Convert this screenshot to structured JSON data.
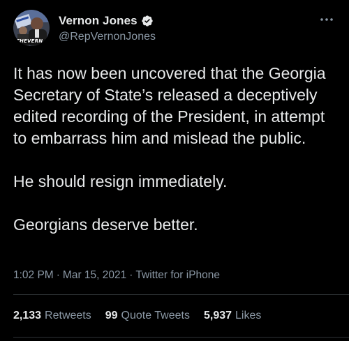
{
  "user": {
    "display_name": "Vernon Jones",
    "handle": "@RepVernonJones",
    "avatar_text": "THEVERN",
    "verified": true
  },
  "tweet": {
    "paragraphs": [
      "It has now been uncovered that the Georgia Secretary of State’s released a deceptively edited recording of the President, in attempt to embarrass him and mislead the public.",
      "He should resign immediately.",
      "Georgians deserve better."
    ],
    "time": "1:02 PM",
    "separator": "·",
    "date": "Mar 15, 2021",
    "source": "Twitter for iPhone"
  },
  "stats": {
    "retweets_count": "2,133",
    "retweets_label": "Retweets",
    "quotes_count": "99",
    "quotes_label": "Quote Tweets",
    "likes_count": "5,937",
    "likes_label": "Likes"
  },
  "icons": {
    "verified": "verified-badge-icon",
    "more": "more-options-icon"
  },
  "colors": {
    "background": "#000000",
    "text_primary": "#e7e9ea",
    "text_secondary": "#8b98a5",
    "divider": "#2f3336"
  }
}
